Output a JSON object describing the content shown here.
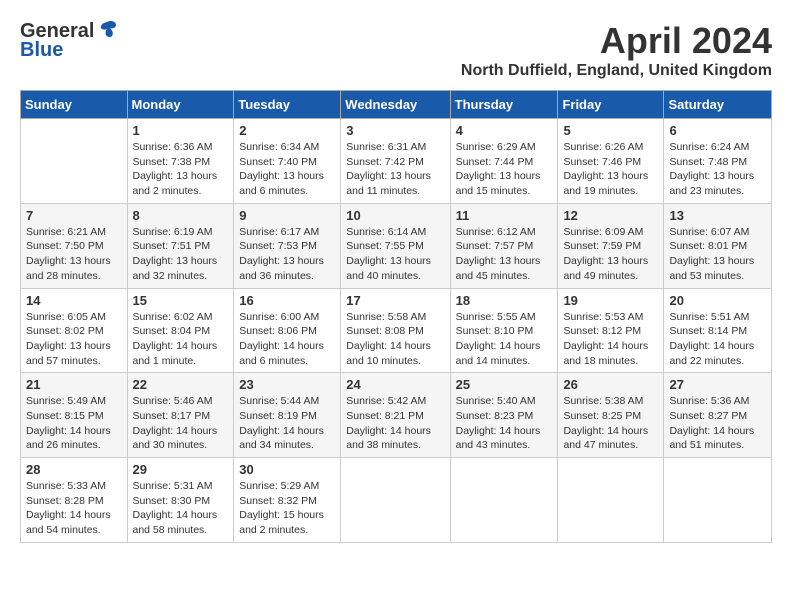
{
  "header": {
    "logo_general": "General",
    "logo_blue": "Blue",
    "title": "April 2024",
    "location": "North Duffield, England, United Kingdom"
  },
  "days_of_week": [
    "Sunday",
    "Monday",
    "Tuesday",
    "Wednesday",
    "Thursday",
    "Friday",
    "Saturday"
  ],
  "weeks": [
    [
      {
        "day": "",
        "info": ""
      },
      {
        "day": "1",
        "info": "Sunrise: 6:36 AM\nSunset: 7:38 PM\nDaylight: 13 hours\nand 2 minutes."
      },
      {
        "day": "2",
        "info": "Sunrise: 6:34 AM\nSunset: 7:40 PM\nDaylight: 13 hours\nand 6 minutes."
      },
      {
        "day": "3",
        "info": "Sunrise: 6:31 AM\nSunset: 7:42 PM\nDaylight: 13 hours\nand 11 minutes."
      },
      {
        "day": "4",
        "info": "Sunrise: 6:29 AM\nSunset: 7:44 PM\nDaylight: 13 hours\nand 15 minutes."
      },
      {
        "day": "5",
        "info": "Sunrise: 6:26 AM\nSunset: 7:46 PM\nDaylight: 13 hours\nand 19 minutes."
      },
      {
        "day": "6",
        "info": "Sunrise: 6:24 AM\nSunset: 7:48 PM\nDaylight: 13 hours\nand 23 minutes."
      }
    ],
    [
      {
        "day": "7",
        "info": "Sunrise: 6:21 AM\nSunset: 7:50 PM\nDaylight: 13 hours\nand 28 minutes."
      },
      {
        "day": "8",
        "info": "Sunrise: 6:19 AM\nSunset: 7:51 PM\nDaylight: 13 hours\nand 32 minutes."
      },
      {
        "day": "9",
        "info": "Sunrise: 6:17 AM\nSunset: 7:53 PM\nDaylight: 13 hours\nand 36 minutes."
      },
      {
        "day": "10",
        "info": "Sunrise: 6:14 AM\nSunset: 7:55 PM\nDaylight: 13 hours\nand 40 minutes."
      },
      {
        "day": "11",
        "info": "Sunrise: 6:12 AM\nSunset: 7:57 PM\nDaylight: 13 hours\nand 45 minutes."
      },
      {
        "day": "12",
        "info": "Sunrise: 6:09 AM\nSunset: 7:59 PM\nDaylight: 13 hours\nand 49 minutes."
      },
      {
        "day": "13",
        "info": "Sunrise: 6:07 AM\nSunset: 8:01 PM\nDaylight: 13 hours\nand 53 minutes."
      }
    ],
    [
      {
        "day": "14",
        "info": "Sunrise: 6:05 AM\nSunset: 8:02 PM\nDaylight: 13 hours\nand 57 minutes."
      },
      {
        "day": "15",
        "info": "Sunrise: 6:02 AM\nSunset: 8:04 PM\nDaylight: 14 hours\nand 1 minute."
      },
      {
        "day": "16",
        "info": "Sunrise: 6:00 AM\nSunset: 8:06 PM\nDaylight: 14 hours\nand 6 minutes."
      },
      {
        "day": "17",
        "info": "Sunrise: 5:58 AM\nSunset: 8:08 PM\nDaylight: 14 hours\nand 10 minutes."
      },
      {
        "day": "18",
        "info": "Sunrise: 5:55 AM\nSunset: 8:10 PM\nDaylight: 14 hours\nand 14 minutes."
      },
      {
        "day": "19",
        "info": "Sunrise: 5:53 AM\nSunset: 8:12 PM\nDaylight: 14 hours\nand 18 minutes."
      },
      {
        "day": "20",
        "info": "Sunrise: 5:51 AM\nSunset: 8:14 PM\nDaylight: 14 hours\nand 22 minutes."
      }
    ],
    [
      {
        "day": "21",
        "info": "Sunrise: 5:49 AM\nSunset: 8:15 PM\nDaylight: 14 hours\nand 26 minutes."
      },
      {
        "day": "22",
        "info": "Sunrise: 5:46 AM\nSunset: 8:17 PM\nDaylight: 14 hours\nand 30 minutes."
      },
      {
        "day": "23",
        "info": "Sunrise: 5:44 AM\nSunset: 8:19 PM\nDaylight: 14 hours\nand 34 minutes."
      },
      {
        "day": "24",
        "info": "Sunrise: 5:42 AM\nSunset: 8:21 PM\nDaylight: 14 hours\nand 38 minutes."
      },
      {
        "day": "25",
        "info": "Sunrise: 5:40 AM\nSunset: 8:23 PM\nDaylight: 14 hours\nand 43 minutes."
      },
      {
        "day": "26",
        "info": "Sunrise: 5:38 AM\nSunset: 8:25 PM\nDaylight: 14 hours\nand 47 minutes."
      },
      {
        "day": "27",
        "info": "Sunrise: 5:36 AM\nSunset: 8:27 PM\nDaylight: 14 hours\nand 51 minutes."
      }
    ],
    [
      {
        "day": "28",
        "info": "Sunrise: 5:33 AM\nSunset: 8:28 PM\nDaylight: 14 hours\nand 54 minutes."
      },
      {
        "day": "29",
        "info": "Sunrise: 5:31 AM\nSunset: 8:30 PM\nDaylight: 14 hours\nand 58 minutes."
      },
      {
        "day": "30",
        "info": "Sunrise: 5:29 AM\nSunset: 8:32 PM\nDaylight: 15 hours\nand 2 minutes."
      },
      {
        "day": "",
        "info": ""
      },
      {
        "day": "",
        "info": ""
      },
      {
        "day": "",
        "info": ""
      },
      {
        "day": "",
        "info": ""
      }
    ]
  ]
}
